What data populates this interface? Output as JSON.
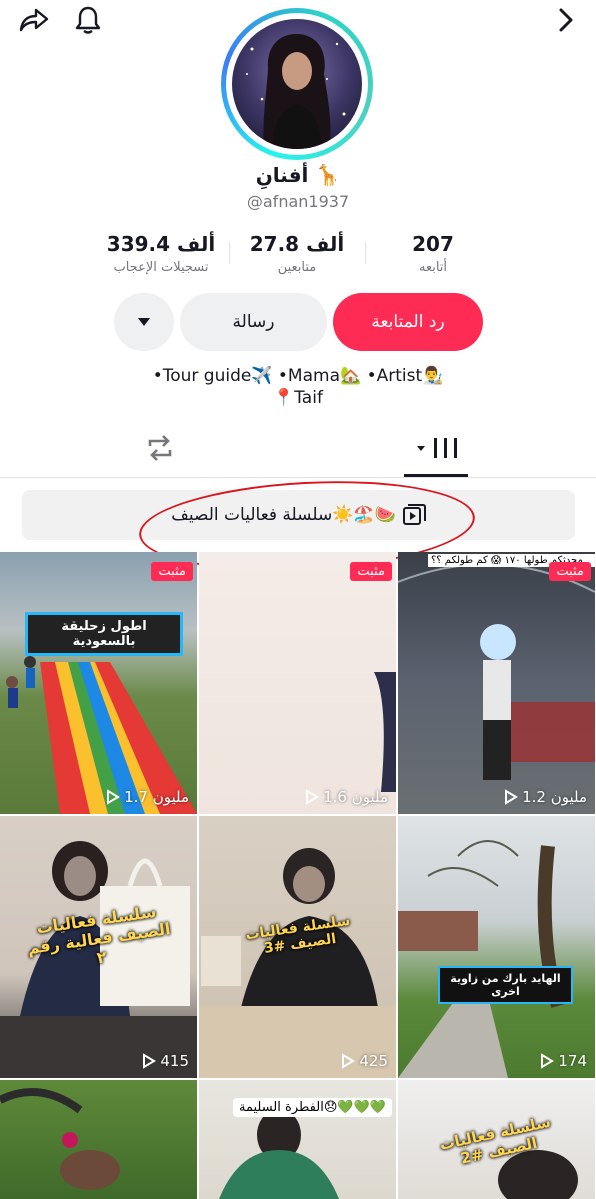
{
  "profile": {
    "name": "أفنانِ 🦒",
    "handle": "@afnan1937"
  },
  "stats": [
    {
      "value": "207",
      "label": "أتابعه"
    },
    {
      "value": "27.8 ألف",
      "label": "متابعين"
    },
    {
      "value": "339.4 ألف",
      "label": "تسجيلات الإعجاب"
    }
  ],
  "actions": {
    "follow_back": "رد المتابعة",
    "message": "رسالة"
  },
  "bio": {
    "line1": "•Tour guide✈️ •Mama🏡 •Artist👨‍🎨",
    "line2": "📍Taif"
  },
  "playlist": {
    "label": "سلسلة فعاليات الصيف☀️🏖️🍉"
  },
  "videos": [
    {
      "pinned": "مثبت",
      "views": "1.7 مليون",
      "caption": "اطول زحليقة بالسعودية"
    },
    {
      "pinned": "مثبت",
      "views": "1.6 مليون",
      "caption": ""
    },
    {
      "pinned": "مثبت",
      "views": "1.2 مليون",
      "caption": "محدثكم طولها ١٧٠ 😱 كم طولكم ؟؟"
    },
    {
      "views": "415",
      "caption": "سلسلة فعاليات الصيف فعالية رقم ٢"
    },
    {
      "views": "425",
      "caption": "سلسلة فعاليات الصيف #3"
    },
    {
      "views": "174",
      "caption": "الهايد بارك من زاوية اخرى"
    },
    {
      "views": "",
      "caption": ""
    },
    {
      "views": "",
      "caption": "الفطرة السليمة😞💚💚💚"
    },
    {
      "views": "",
      "caption": "سلسلة فعاليات الصيف #2"
    }
  ],
  "colors": {
    "accent": "#fe2c55",
    "annotation": "#d8171d"
  }
}
